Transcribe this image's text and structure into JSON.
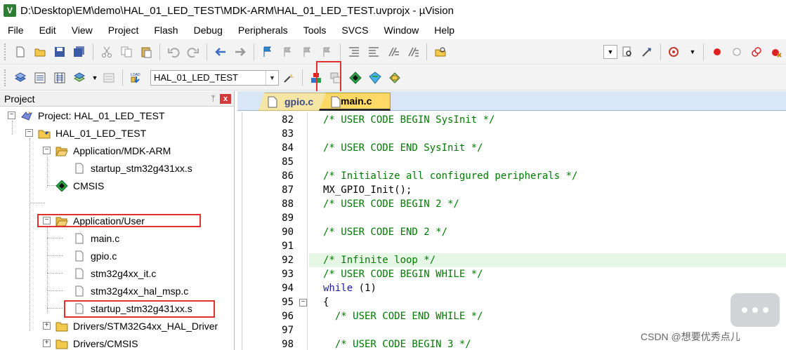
{
  "window": {
    "icon_letter": "V",
    "title": "D:\\Desktop\\EM\\demo\\HAL_01_LED_TEST\\MDK-ARM\\HAL_01_LED_TEST.uvprojx - µVision"
  },
  "menu": [
    "File",
    "Edit",
    "View",
    "Project",
    "Flash",
    "Debug",
    "Peripherals",
    "Tools",
    "SVCS",
    "Window",
    "Help"
  ],
  "toolbar2": {
    "target": "HAL_01_LED_TEST",
    "load_label": "LOAD"
  },
  "project_panel": {
    "title": "Project",
    "pin": "ᛘ",
    "close": "x",
    "tree": [
      {
        "label": "Project: HAL_01_LED_TEST",
        "expander": "−"
      },
      {
        "label": "HAL_01_LED_TEST",
        "expander": "−"
      },
      {
        "label": "Application/MDK-ARM",
        "expander": "−"
      },
      {
        "label": "startup_stm32g431xx.s"
      },
      {
        "label": "CMSIS"
      },
      {
        "label": "Application/User",
        "expander": "−"
      },
      {
        "label": "main.c"
      },
      {
        "label": "gpio.c"
      },
      {
        "label": "stm32g4xx_it.c"
      },
      {
        "label": "stm32g4xx_hal_msp.c"
      },
      {
        "label": "startup_stm32g431xx.s"
      },
      {
        "label": "Drivers/STM32G4xx_HAL_Driver",
        "expander": "+"
      },
      {
        "label": "Drivers/CMSIS",
        "expander": "+"
      }
    ]
  },
  "editor": {
    "tabs": [
      {
        "label": "gpio.c",
        "active": false
      },
      {
        "label": "main.c",
        "active": true
      }
    ],
    "lines": [
      {
        "n": "82",
        "text": "/* USER CODE BEGIN SysInit */"
      },
      {
        "n": "83",
        "text": ""
      },
      {
        "n": "84",
        "text": "/* USER CODE END SysInit */"
      },
      {
        "n": "85",
        "text": ""
      },
      {
        "n": "86",
        "text": "/* Initialize all configured peripherals */"
      },
      {
        "n": "87",
        "text": "MX_GPIO_Init();"
      },
      {
        "n": "88",
        "text": "/* USER CODE BEGIN 2 */"
      },
      {
        "n": "89",
        "text": ""
      },
      {
        "n": "90",
        "text": "/* USER CODE END 2 */"
      },
      {
        "n": "91",
        "text": ""
      },
      {
        "n": "92",
        "text": "/* Infinite loop */"
      },
      {
        "n": "93",
        "text": "/* USER CODE BEGIN WHILE */"
      },
      {
        "n": "94",
        "text_kw": "while",
        "text_rest": " (1)"
      },
      {
        "n": "95",
        "text": "{",
        "fold": "−"
      },
      {
        "n": "96",
        "text": "  /* USER CODE END WHILE */"
      },
      {
        "n": "97",
        "text": ""
      },
      {
        "n": "98",
        "text": "  /* USER CODE BEGIN 3 */"
      }
    ]
  },
  "watermark": "CSDN @想要优秀点儿"
}
